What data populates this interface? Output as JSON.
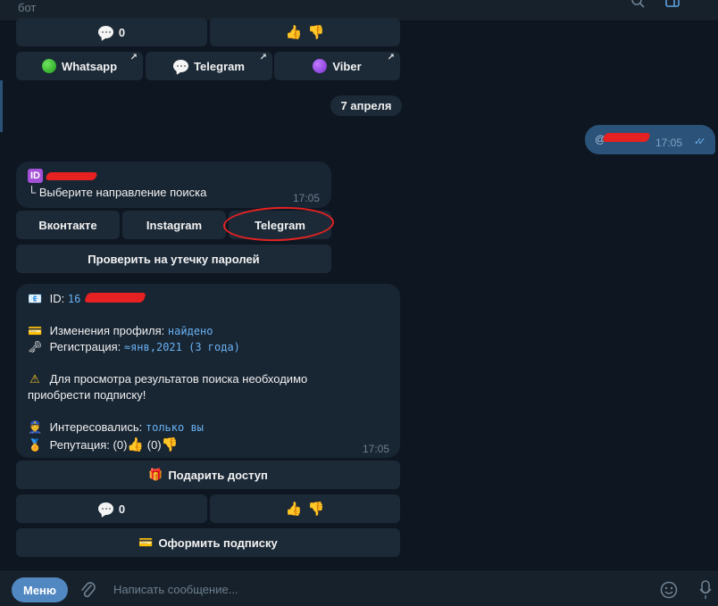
{
  "header": {
    "subtitle": "бот"
  },
  "top_keyboard": {
    "comments_count": "0",
    "links": [
      {
        "label": "Whatsapp",
        "icon": "green-circle-icon"
      },
      {
        "label": "Telegram",
        "icon": "speech-bubble-icon"
      },
      {
        "label": "Viber",
        "icon": "purple-circle-icon"
      }
    ]
  },
  "date_separator": "7 апреля",
  "outgoing_message": {
    "text_prefix": "@",
    "time": "17:05"
  },
  "direction_message": {
    "badge": "ID",
    "prompt": "└ Выберите направление поиска",
    "time": "17:05",
    "buttons": [
      "Вконтакте",
      "Instagram",
      "Telegram"
    ],
    "leak_button": "Проверить на утечку паролей"
  },
  "result_message": {
    "id_label": "ID:",
    "id_value_visible": "16",
    "profile_changes_label": "Изменения профиля:",
    "profile_changes_value": "найдено",
    "registration_label": "Регистрация:",
    "registration_value": "≈янв,2021 (3 года)",
    "warning_text_line1": "Для просмотра результатов поиска необходимо",
    "warning_text_line2": "приобрести подписку!",
    "interested_label": "Интересовались:",
    "interested_value": "только вы",
    "reputation_label": "Репутация:",
    "reputation_pos": "(0)",
    "reputation_neg": "(0)",
    "time": "17:05"
  },
  "bottom_keyboard": {
    "gift_button": "Подарить доступ",
    "comments_count": "0",
    "subscribe_button": "Оформить подписку"
  },
  "input_bar": {
    "menu_label": "Меню",
    "placeholder": "Написать сообщение..."
  },
  "colors": {
    "background": "#0e1621",
    "bubble": "#182533",
    "outgoing": "#2b5278",
    "accent": "#6ab3f3",
    "annotation_red": "#e52222"
  }
}
